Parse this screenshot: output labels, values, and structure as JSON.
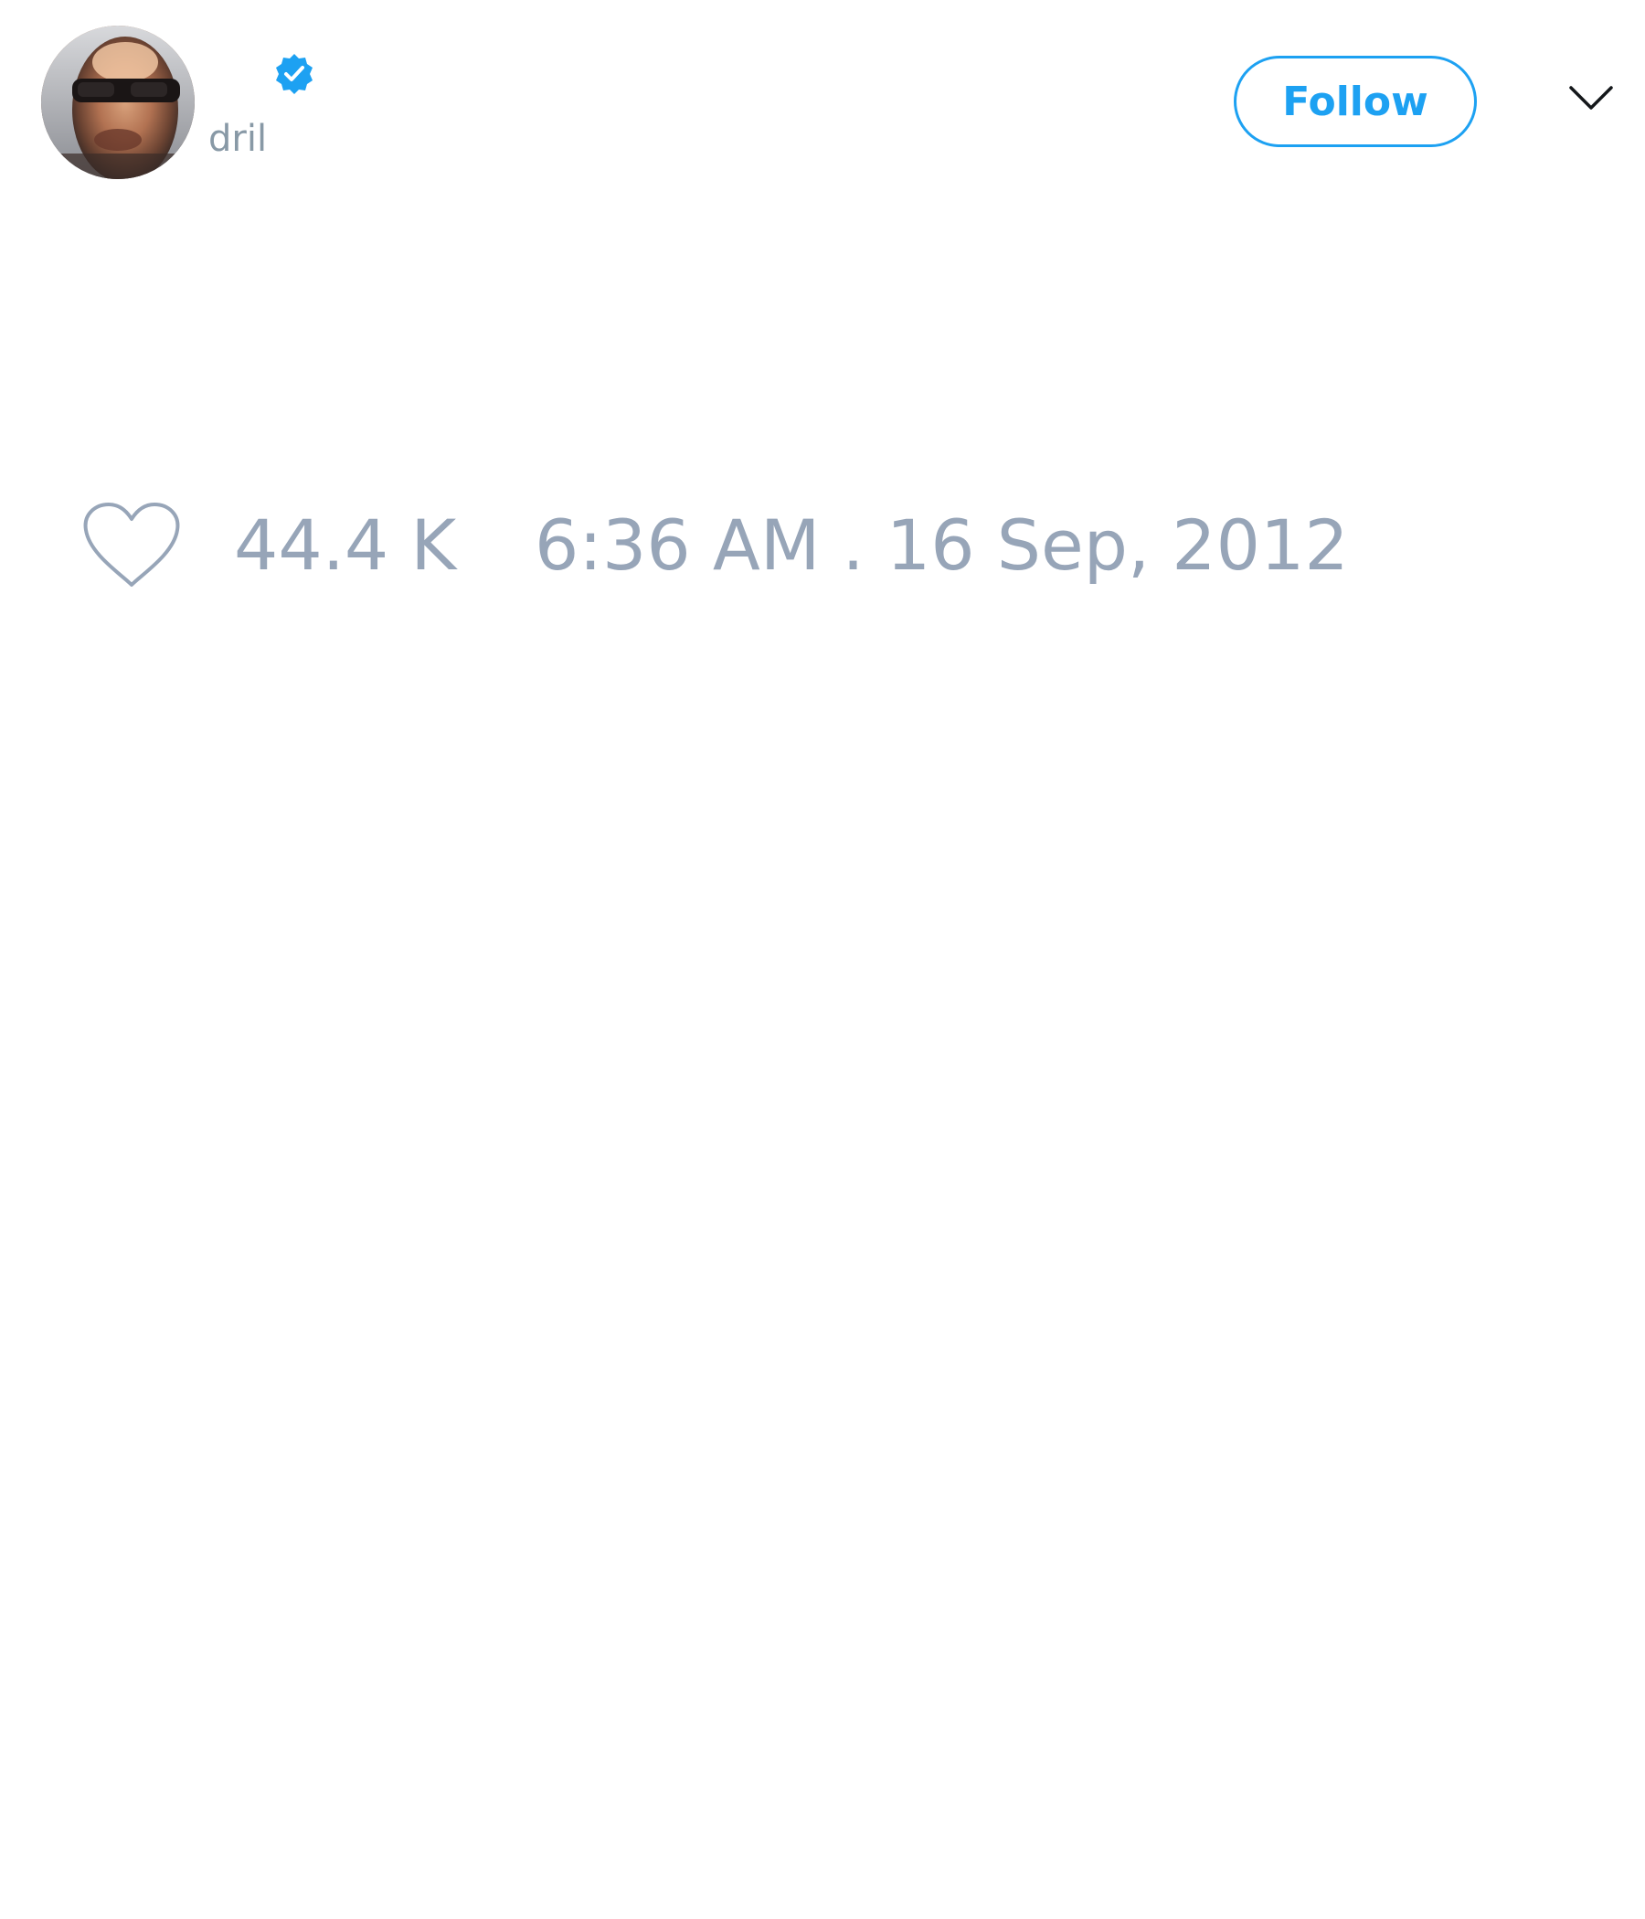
{
  "author": {
    "display_name": "",
    "handle": "dril",
    "verified_icon": "verified-badge-icon",
    "avatar": "profile-photo"
  },
  "header": {
    "follow_label": "Follow",
    "menu_icon": "chevron-down-icon"
  },
  "footer": {
    "like_icon": "heart-icon",
    "like_count": "44.4 K",
    "timestamp": "6:36 AM . 16 Sep, 2012"
  },
  "colors": {
    "accent": "#1da1f2",
    "muted_text": "#97a5b8",
    "background": "#ffffff"
  }
}
